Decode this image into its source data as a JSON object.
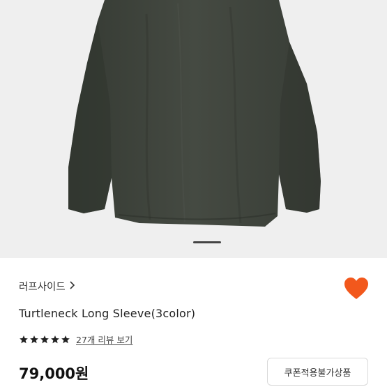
{
  "product": {
    "brand": "러프사이드",
    "brand_chevron": "chevron-right-icon",
    "title": "Turtleneck Long Sleeve(3color)",
    "rating_stars": 5,
    "reviews_link": "27개 리뷰 보기",
    "price": "79,000원",
    "coupon_badge": "쿠폰적용불가상품"
  },
  "gallery": {
    "image_subject": "dark olive long sleeve turtleneck",
    "indicator_icon": "carousel-indicator"
  },
  "colors": {
    "heart": "#f2581c",
    "star": "#222222",
    "background_hero": "#efefef",
    "garment": "#3e433c"
  },
  "icons": {
    "favorite": "heart-icon",
    "star": "star-icon"
  }
}
